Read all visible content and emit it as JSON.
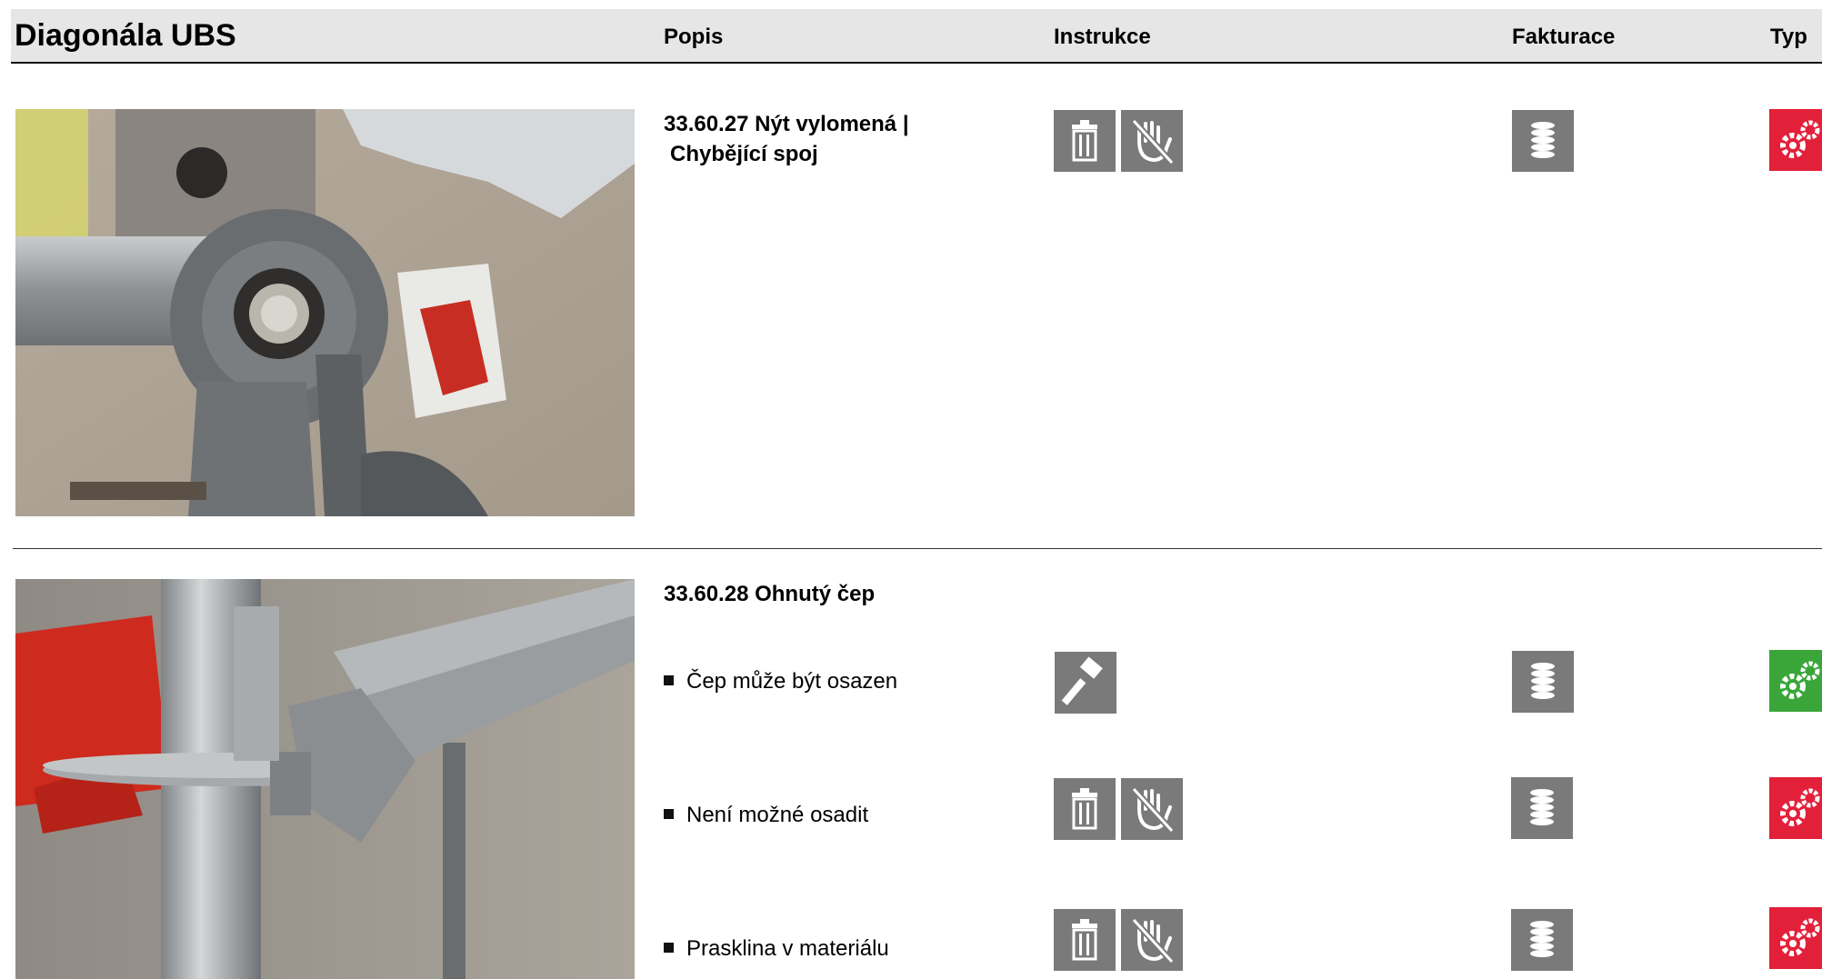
{
  "header": {
    "title": "Diagonála UBS",
    "col_popis": "Popis",
    "col_instrukce": "Instrukce",
    "col_fakturace": "Fakturace",
    "col_typ": "Typ"
  },
  "sections": [
    {
      "code_line1": "33.60.27 Nýt vylomená |",
      "code_line2": "Chybějící spoj",
      "rows": [
        {
          "instructions": [
            "trash-icon",
            "no-hand-icon"
          ],
          "billing": "coins-icon",
          "type_color": "#e3203a"
        }
      ]
    },
    {
      "code_line1": "33.60.28 Ohnutý čep",
      "rows": [
        {
          "text": "Čep může být osazen",
          "instructions": [
            "hammer-icon"
          ],
          "billing": "coins-icon",
          "type_color": "#3aa639"
        },
        {
          "text": "Není možné osadit",
          "instructions": [
            "trash-icon",
            "no-hand-icon"
          ],
          "billing": "coins-icon",
          "type_color": "#e3203a"
        },
        {
          "text": "Prasklina v materiálu",
          "instructions": [
            "trash-icon",
            "no-hand-icon"
          ],
          "billing": "coins-icon",
          "type_color": "#e3203a"
        }
      ]
    }
  ],
  "icon_bg_color": "#7a7a7a"
}
